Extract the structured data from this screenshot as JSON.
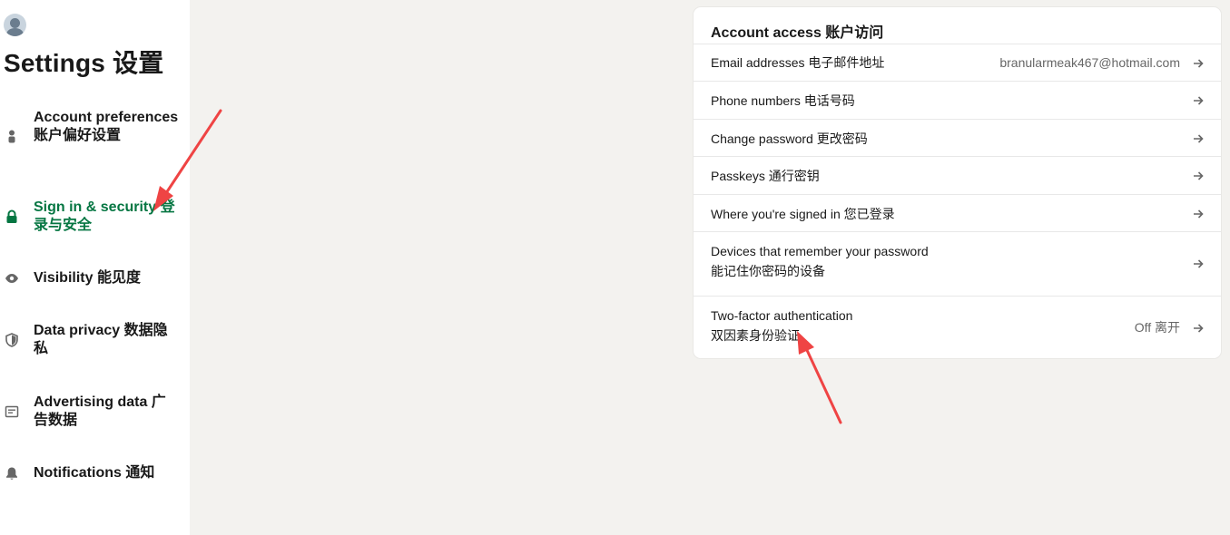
{
  "sidebar": {
    "title": "Settings  设置",
    "items": [
      {
        "label": "Account preferences  账户偏好设置",
        "icon": "person-icon",
        "active": false
      },
      {
        "label": "Sign in & security  登录与安全",
        "icon": "lock-icon",
        "active": true
      },
      {
        "label": "Visibility  能见度",
        "icon": "eye-icon",
        "active": false
      },
      {
        "label": "Data privacy  数据隐私",
        "icon": "shield-icon",
        "active": false
      },
      {
        "label": "Advertising data  广告数据",
        "icon": "ad-icon",
        "active": false
      },
      {
        "label": "Notifications  通知",
        "icon": "bell-icon",
        "active": false
      }
    ]
  },
  "card": {
    "title": "Account access  账户访问",
    "rows": [
      {
        "label": "Email addresses  电子邮件地址",
        "value": "branularmeak467@hotmail.com"
      },
      {
        "label": "Phone numbers  电话号码",
        "value": ""
      },
      {
        "label": "Change password  更改密码",
        "value": ""
      },
      {
        "label": "Passkeys  通行密钥",
        "value": ""
      },
      {
        "label": "Where you're signed in  您已登录",
        "value": ""
      },
      {
        "label": "Devices that remember your password",
        "label2": "能记住你密码的设备",
        "value": ""
      },
      {
        "label": "Two-factor authentication",
        "label2": "双因素身份验证",
        "value": "Off  离开"
      }
    ]
  },
  "colors": {
    "active": "#057642",
    "annotation": "#ef4444",
    "background": "#f3f2ef"
  }
}
